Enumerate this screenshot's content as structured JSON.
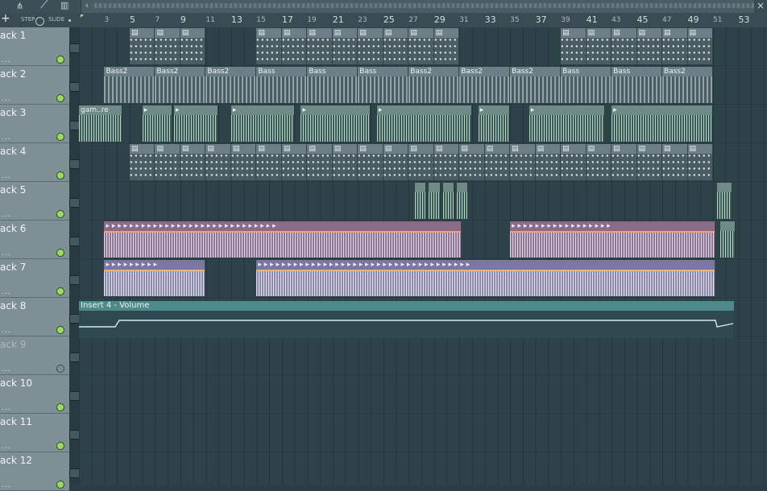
{
  "toolbar": {
    "step_label": "STEP",
    "slide_label": "SLIDE",
    "plus": "+",
    "close": "×",
    "back": "‹"
  },
  "ruler": {
    "bars": [
      "3",
      "5",
      "7",
      "9",
      "11",
      "13",
      "15",
      "17",
      "19",
      "21",
      "23",
      "25",
      "27",
      "29",
      "31",
      "33",
      "35",
      "37",
      "39",
      "41",
      "43",
      "45",
      "47",
      "49",
      "51",
      "53"
    ]
  },
  "tracks": [
    {
      "label": "ack 1",
      "enabled": true
    },
    {
      "label": "ack 2",
      "enabled": true
    },
    {
      "label": "ack 3",
      "enabled": true
    },
    {
      "label": "ack 4",
      "enabled": true
    },
    {
      "label": "ack 5",
      "enabled": true
    },
    {
      "label": "ack 6",
      "enabled": true
    },
    {
      "label": "ack 7",
      "enabled": true
    },
    {
      "label": "ack 8",
      "enabled": true
    },
    {
      "label": "ack 9",
      "enabled": false
    },
    {
      "label": "ack 10",
      "enabled": true
    },
    {
      "label": "ack 11",
      "enabled": true
    },
    {
      "label": "ack 12",
      "enabled": true
    }
  ],
  "clips": {
    "bass2_label": "Bass2",
    "bass_label": "Bass",
    "audio_label": "gam..re",
    "automation_label": "Insert 4 - Volume"
  }
}
